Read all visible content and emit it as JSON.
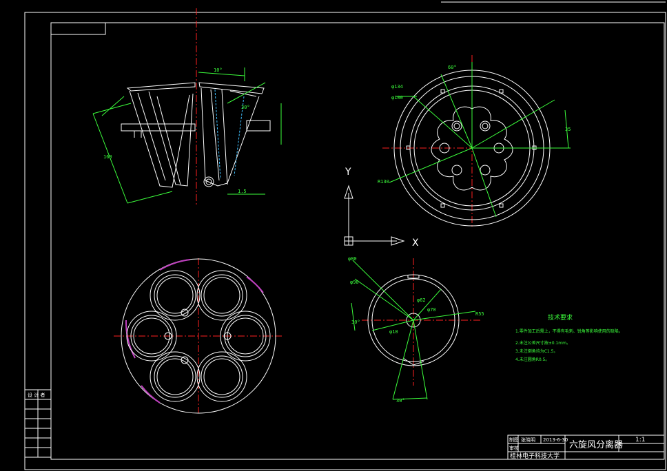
{
  "colors": {
    "background": "#000000",
    "outline": "#ffffff",
    "centerline": "#ff2020",
    "dimension": "#3cff3c",
    "hatch": "#c040c0",
    "hidden": "#40c0ff"
  },
  "title_block": {
    "drawing_name": "六旋风分离器",
    "scale": "1:1",
    "date": "2013-6-30",
    "school": "桂林电子科技大学",
    "designer_label": "制图",
    "designer_name": "张晓明",
    "checker_label": "审核"
  },
  "left_table": {
    "header": "设 计 者"
  },
  "tech_notes": {
    "title": "技术要求",
    "lines": [
      "1.零件加工后需上，不得有毛刺、锐角等影响使用的缺陷。",
      "2.未注公差尺寸按±0.1mm。",
      "3.未注倒角均为C1.5。",
      "4.未注圆角R0.5。"
    ]
  },
  "ucs": {
    "x_label": "X",
    "y_label": "Y"
  },
  "dimensions": {
    "cone_angle_top": "10°",
    "cone_height": "160",
    "cone_angle_right": "30°",
    "cone_right_small": "1.5",
    "plan_dia_outer": "φ134",
    "plan_dia_inner": "φ100",
    "plan_r_small": "R130",
    "plan_angle_top": "60°",
    "plan_right": "35",
    "ring_d1": "φ80",
    "ring_d2": "φ90",
    "ring_d3": "φ70",
    "ring_d4": "φ62",
    "ring_d5": "φ10",
    "ring_r": "R55",
    "ring_angle_left": "30°",
    "ring_angle_bottom": "30°"
  }
}
